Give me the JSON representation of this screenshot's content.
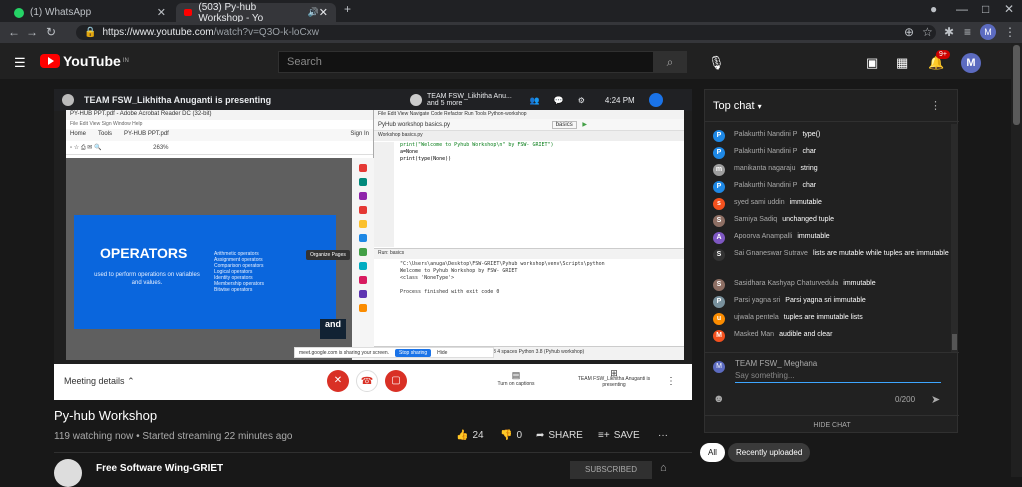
{
  "browser": {
    "tabs": [
      {
        "title": "(1) WhatsApp",
        "active": false,
        "icon": "whatsapp-icon"
      },
      {
        "title": "(503) Py-hub Workshop - Yo",
        "active": true,
        "icon": "youtube-icon"
      }
    ],
    "url": "https://www.youtube.com/watch?v=Q3O-k-loCxw",
    "url_domain": "https://www.youtube.com",
    "url_path": "/watch?v=Q3O-k-loCxw",
    "profile_initial": "M"
  },
  "header": {
    "logo_text": "YouTube",
    "logo_sup": "IN",
    "search_placeholder": "Search",
    "notification_count": "9+",
    "avatar_initial": "M"
  },
  "meet": {
    "presenting_text": "TEAM FSW_Likhitha Anuganti is presenting",
    "tile_name": "TEAM FSW_Likhitha Anu...",
    "tile_sub": "and 5 more",
    "time": "4:24 PM",
    "meeting_details": "Meeting details",
    "captions_label": "Turn on captions",
    "presenting_footer": "TEAM FSW_Likhitha Anuganti is presenting"
  },
  "pdf": {
    "title": "PY-HUB PPT.pdf - Adobe Acrobat Reader DC (32-bit)",
    "menu": "File Edit View Sign Window Help",
    "tabs": [
      "Home",
      "Tools",
      "PY-HUB PPT.pdf"
    ],
    "sign_in": "Sign In",
    "zoom": "263%",
    "slide_title": "OPERATORS",
    "slide_subtitle": "used to perform operations on variables and values.",
    "slide_list": [
      "Arithmetic operators",
      "Assignment operators",
      "Comparison operators",
      "Logical operators",
      "Identity operators",
      "Membership operators",
      "Bitwise operators"
    ],
    "logo_text": "and",
    "tooltip": "Organize Pages"
  },
  "ide": {
    "menu": "File Edit View Navigate Code Refactor Run Tools Python-workshop",
    "nav": "PyHub workshop  basics.py",
    "run_config": "basics",
    "tabs": "Workshop  basics.py",
    "code": [
      "print(\"Welcome to Pyhub Workshop\\n\" by FSW- GRIET\")",
      "a=None",
      "print(type(None))"
    ],
    "run_label": "Run: basics",
    "output": [
      "\"C:\\Users\\anuga\\Desktop\\FSW-GRIET\\Pyhub workshop\\venv\\Scripts\\python",
      "Welcome to Pyhub Workshop by FSW- GRIET",
      "<class 'NoneType'>",
      "",
      "Process finished with exit code 0"
    ],
    "status": "Terminal  Python Console  Event Log   3:6 CRLF UTF-8 4 spaces Python 3.8 (Pyhub workshop)",
    "share_banner": "meet.google.com is sharing your screen.",
    "stop_sharing": "Stop sharing",
    "hide": "Hide"
  },
  "video": {
    "title": "Py-hub Workshop",
    "meta": "119 watching now • Started streaming 22 minutes ago",
    "likes": "24",
    "dislikes": "0",
    "share": "SHARE",
    "save": "SAVE",
    "channel": "Free Software Wing-GRIET",
    "subscribe": "SUBSCRIBED"
  },
  "chat": {
    "title": "Top chat",
    "messages": [
      {
        "author": "Palakurthi Nandini P",
        "text": "type()",
        "initial": "P",
        "color": "#1e88e5"
      },
      {
        "author": "Palakurthi Nandini P",
        "text": "char",
        "initial": "P",
        "color": "#1e88e5"
      },
      {
        "author": "manikanta nagaraju",
        "text": "string",
        "initial": "m",
        "color": "#9e9e9e"
      },
      {
        "author": "Palakurthi Nandini P",
        "text": "char",
        "initial": "P",
        "color": "#1e88e5"
      },
      {
        "author": "syed sami uddin",
        "text": "immutable",
        "initial": "s",
        "color": "#f4511e"
      },
      {
        "author": "Samiya Sadiq",
        "text": "unchanged tuple",
        "initial": "S",
        "color": "#8d6e63"
      },
      {
        "author": "Apoorva Anampalli",
        "text": "immutable",
        "initial": "A",
        "color": "#7e57c2"
      },
      {
        "author": "Sai Gnaneswar Sutrave",
        "text": "lists are mutable while tuples are immutable",
        "initial": "S",
        "color": "#333333"
      },
      {
        "author": "Sasidhara Kashyap Chaturvedula",
        "text": "immutable",
        "initial": "S",
        "color": "#8d6e63"
      },
      {
        "author": "Parsi yagna sri",
        "text": "Parsi yagna sri  immutable",
        "initial": "P",
        "color": "#78909c"
      },
      {
        "author": "ujwala pentela",
        "text": "tuples are immutable lists",
        "initial": "u",
        "color": "#fb8c00"
      },
      {
        "author": "Masked Man",
        "text": "audible and clear",
        "initial": "M",
        "color": "#f4511e"
      }
    ],
    "me_name": "TEAM FSW_ Meghana",
    "me_initial": "M",
    "placeholder": "Say something...",
    "counter": "0/200",
    "hide_chat": "HIDE CHAT"
  },
  "chips": [
    "All",
    "Recently uploaded"
  ]
}
